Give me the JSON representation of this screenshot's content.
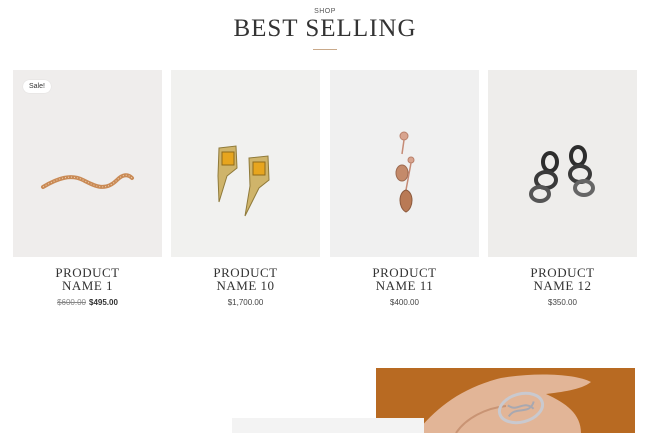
{
  "header": {
    "eyebrow": "SHOP",
    "title": "BEST SELLING"
  },
  "products": [
    {
      "name_line1": "PRODUCT",
      "name_line2": "NAME 1",
      "old_price": "$600.00",
      "price": "$495.00",
      "badge": "Sale!",
      "image": "wavy-gold-brooch"
    },
    {
      "name_line1": "PRODUCT",
      "name_line2": "NAME 10",
      "price": "$1,700.00",
      "image": "gold-citrine-earrings"
    },
    {
      "name_line1": "PRODUCT",
      "name_line2": "NAME 11",
      "price": "$400.00",
      "image": "rose-gold-drop-earrings"
    },
    {
      "name_line1": "PRODUCT",
      "name_line2": "NAME 12",
      "price": "$350.00",
      "image": "black-silver-chain-earrings"
    }
  ],
  "colors": {
    "accent_rule": "#c9a98a",
    "promo_bg": "#b86a22"
  }
}
